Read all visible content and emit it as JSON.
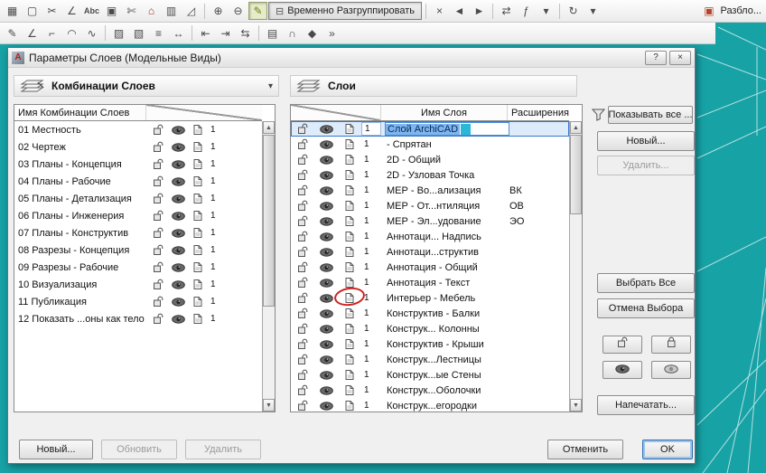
{
  "colors": {
    "workspace": "#17a2a6",
    "selection_blue": "#7fb4ef",
    "annotation_red": "#cc2222"
  },
  "toolbar": {
    "ungroup_label": "Временно Разгруппировать",
    "unlock_label": "Разбло...",
    "row1": [
      {
        "name": "hatch-tool-icon",
        "glyph": "▦"
      },
      {
        "name": "marquee-tool-icon",
        "glyph": "▢"
      },
      {
        "name": "scissors-icon",
        "glyph": "✂"
      },
      {
        "name": "angle-dimension-icon",
        "glyph": "∠"
      },
      {
        "name": "spellcheck-icon",
        "glyph": "Abc",
        "small": true
      },
      {
        "name": "figure-tool-icon",
        "glyph": "▣"
      },
      {
        "name": "knife-tool-icon",
        "glyph": "✄"
      },
      {
        "name": "home-icon",
        "glyph": "⌂",
        "color": "#a63324"
      },
      {
        "name": "column-tool-icon",
        "glyph": "▥"
      },
      {
        "name": "measure-tool-icon",
        "glyph": "◿"
      },
      {
        "type": "sep"
      },
      {
        "name": "zoom-in-icon",
        "glyph": "⊕"
      },
      {
        "name": "zoom-out-icon",
        "glyph": "⊖"
      },
      {
        "name": "highlighter-icon",
        "glyph": "✎",
        "active": true,
        "color": "#6f7f18"
      },
      {
        "type": "ungroup"
      },
      {
        "type": "sep"
      },
      {
        "name": "cancel-icon",
        "glyph": "×"
      },
      {
        "name": "back-arrow-icon",
        "glyph": "◄"
      },
      {
        "name": "forward-arrow-icon",
        "glyph": "►"
      },
      {
        "type": "sep"
      },
      {
        "name": "swap-arrows-icon",
        "glyph": "⇄"
      },
      {
        "name": "function-icon",
        "glyph": "ƒ"
      },
      {
        "name": "chevron-down-icon",
        "glyph": "▾"
      },
      {
        "type": "sep"
      },
      {
        "name": "rotate-icon",
        "glyph": "↻"
      },
      {
        "name": "chevron-down-icon",
        "glyph": "▾"
      },
      {
        "type": "spacer"
      },
      {
        "name": "unlock-flag-icon",
        "glyph": "▣",
        "color": "#b5432a"
      }
    ],
    "row2": [
      {
        "name": "pencil-tool-icon",
        "glyph": "✎"
      },
      {
        "name": "corner-tool-icon",
        "glyph": "∠"
      },
      {
        "name": "offset-tool-icon",
        "glyph": "⌐"
      },
      {
        "name": "arc-tool-icon",
        "glyph": "◠"
      },
      {
        "name": "spline-tool-icon",
        "glyph": "∿"
      },
      {
        "type": "sep"
      },
      {
        "name": "fill-hatch-icon",
        "glyph": "▨"
      },
      {
        "name": "fill-hatch-icon-2",
        "glyph": "▧"
      },
      {
        "name": "line-stack-icon",
        "glyph": "≡"
      },
      {
        "name": "dimension-icon",
        "glyph": "↔"
      },
      {
        "type": "sep"
      },
      {
        "name": "align-left-icon",
        "glyph": "⇤"
      },
      {
        "name": "align-right-icon",
        "glyph": "⇥"
      },
      {
        "name": "distribute-icon",
        "glyph": "⇆"
      },
      {
        "type": "sep"
      },
      {
        "name": "group-tool-icon",
        "glyph": "▤"
      },
      {
        "name": "magnet-tool-icon",
        "glyph": "∩"
      },
      {
        "name": "pen-set-icon",
        "glyph": "◆"
      },
      {
        "name": "more-tools-icon",
        "glyph": "»"
      }
    ]
  },
  "dialog": {
    "title": "Параметры Слоев (Модельные Виды)",
    "help_label": "?",
    "close_label": "×",
    "left_panel": {
      "header": "Комбинации Слоев",
      "name_column": "Имя Комбинации Слоев",
      "status_value": "1",
      "rows": [
        "01 Местность",
        "02 Чертеж",
        "03 Планы - Концепция",
        "04 Планы - Рабочие",
        "05 Планы - Детализация",
        "06 Планы - Инженерия",
        "07 Планы - Конструктив",
        "08 Разрезы - Концепция",
        "09 Разрезы - Рабочие",
        "10 Визуализация",
        "11 Публикация",
        "12 Показать ...оны как тело"
      ]
    },
    "right_panel": {
      "header": "Слои",
      "name_column": "Имя Слоя",
      "ext_column": "Расширения",
      "status_value": "1",
      "rows": [
        {
          "name": "Слой ArchiCAD",
          "ext": "",
          "selected": true
        },
        {
          "name": "- Спрятан",
          "ext": ""
        },
        {
          "name": "2D - Общий",
          "ext": ""
        },
        {
          "name": "2D - Узловая Точка",
          "ext": ""
        },
        {
          "name": "МЕР - Во...ализация",
          "ext": "ВК"
        },
        {
          "name": "МЕР - От...нтиляция",
          "ext": "ОВ"
        },
        {
          "name": "МЕР - Эл...удование",
          "ext": "ЭО"
        },
        {
          "name": "Аннотаци... Надпись",
          "ext": ""
        },
        {
          "name": "Аннотаци...структив",
          "ext": ""
        },
        {
          "name": "Аннотация - Общий",
          "ext": ""
        },
        {
          "name": "Аннотация - Текст",
          "ext": ""
        },
        {
          "name": "Интерьер - Мебель",
          "ext": "",
          "circled": true
        },
        {
          "name": "Конструктив - Балки",
          "ext": ""
        },
        {
          "name": "Конструк... Колонны",
          "ext": ""
        },
        {
          "name": "Конструктив - Крыши",
          "ext": ""
        },
        {
          "name": "Конструк...Лестницы",
          "ext": ""
        },
        {
          "name": "Конструк...ые Стены",
          "ext": ""
        },
        {
          "name": "Конструк...Оболочки",
          "ext": ""
        },
        {
          "name": "Конструк...егородки",
          "ext": ""
        }
      ]
    },
    "side": {
      "show_all": "Показывать все ...",
      "new": "Новый...",
      "delete": "Удалить...",
      "select_all": "Выбрать Все",
      "deselect_all": "Отмена Выбора",
      "print": "Напечатать..."
    },
    "footer": {
      "new": "Новый...",
      "update": "Обновить",
      "delete": "Удалить",
      "cancel": "Отменить",
      "ok": "OK"
    }
  }
}
